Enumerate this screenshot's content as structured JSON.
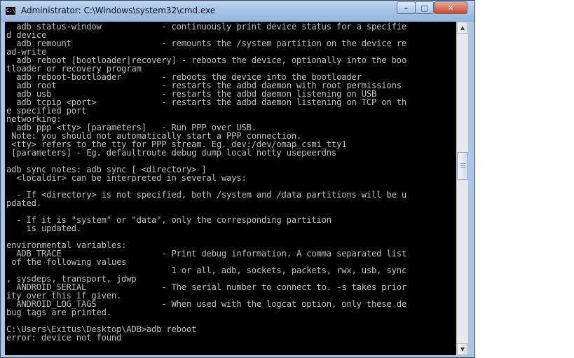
{
  "window": {
    "title": "Administrator: C:\\Windows\\system32\\cmd.exe",
    "icon_label": "C:\\",
    "controls": {
      "minimize": "–",
      "maximize": "□",
      "close": "✕"
    }
  },
  "console": {
    "text": "  adb status-window            - continuously print device status for a specifie\nd device\n  adb remount                  - remounts the /system partition on the device re\nad-write\n  adb reboot [bootloader|recovery] - reboots the device, optionally into the boo\ntloader or recovery program\n  adb reboot-bootloader        - reboots the device into the bootloader\n  adb root                     - restarts the adbd daemon with root permissions\n  adb usb                      - restarts the adbd daemon listening on USB\n  adb tcpip <port>             - restarts the adbd daemon listening on TCP on th\ne specified port\nnetworking:\n  adb ppp <tty> [parameters]   - Run PPP over USB.\n Note: you should not automatically start a PPP connection.\n <tty> refers to the tty for PPP stream. Eg. dev:/dev/omap_csmi_tty1\n [parameters] - Eg. defaultroute debug dump local notty usepeerdns\n\nadb sync notes: adb sync [ <directory> ]\n  <localdir> can be interpreted in several ways:\n\n  - If <directory> is not specified, both /system and /data partitions will be u\npdated.\n\n  - If it is \"system\" or \"data\", only the corresponding partition\n    is updated.\n\nenvironmental variables:\n  ADB_TRACE                    - Print debug information. A comma separated list\n of the following values\n                                 1 or all, adb, sockets, packets, rwx, usb, sync\n, sysdeps, transport, jdwp\n  ANDROID_SERIAL               - The serial number to connect to. -s takes prior\nity over this if given.\n  ANDROID_LOG_TAGS             - When used with the logcat option, only these de\nbug tags are printed.\n\nC:\\Users\\Exitus\\Desktop\\ADB>adb reboot\nerror: device not found"
  },
  "scrollbar": {
    "up_arrow": "▲",
    "down_arrow": "▼",
    "position": 0.42
  }
}
